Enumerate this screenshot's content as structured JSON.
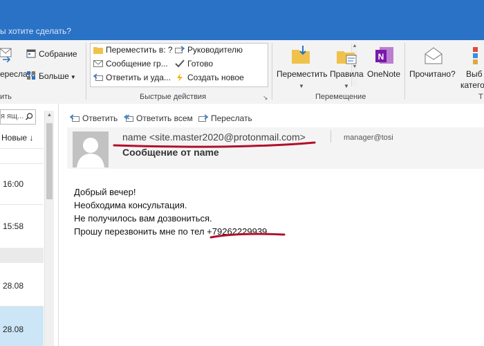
{
  "app": {
    "tell_me": "ы хотите сделать?"
  },
  "ribbon": {
    "respond_group": {
      "forward_label": "ереслать",
      "group_label": "ить"
    },
    "meeting_label": "Собрание",
    "more_label": "Больше",
    "quick_steps": {
      "items_left": [
        "Переместить в: ?",
        "Сообщение гр...",
        "Ответить и уда..."
      ],
      "items_right": [
        "Руководителю",
        "Готово",
        "Создать новое"
      ],
      "group_label": "Быстрые действия"
    },
    "move_group": {
      "move_label": "Переместить",
      "rules_label": "Правила",
      "onenote_label": "OneNote",
      "group_label": "Перемещение"
    },
    "tags_group": {
      "read_label": "Прочитано?",
      "categorize_label_1": "Выб",
      "categorize_label_2": "катего",
      "group_label": "Т"
    }
  },
  "list": {
    "search_placeholder": "я ящ...",
    "sort_label": "Новые",
    "items": [
      {
        "time": "16:00"
      },
      {
        "time": "15:58"
      },
      {
        "time": "28.08"
      },
      {
        "time": "28.08"
      }
    ]
  },
  "reading": {
    "actions": {
      "reply": "Ответить",
      "reply_all": "Ответить всем",
      "forward": "Переслать"
    },
    "from": "name <site.master2020@protonmail.com>",
    "to": "manager@tosi",
    "subject": "Сообщение от name",
    "body_lines": [
      "Добрый вечер!",
      "Необходима консультация.",
      "Не получилось вам дозвониться.",
      "Прошу перезвонить мне по тел +79262229939"
    ]
  },
  "colors": {
    "title_bar": "#2a72c5",
    "annotation_red": "#b0102a",
    "selected_row": "#cde6f7"
  }
}
